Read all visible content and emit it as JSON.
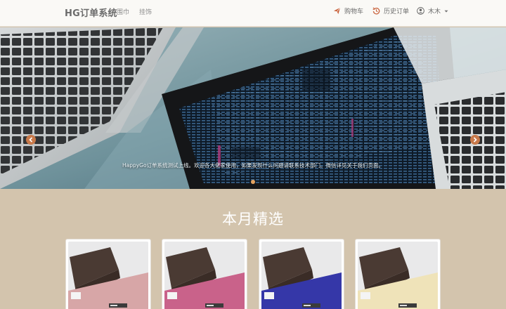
{
  "navbar": {
    "brand": "HG订单系统",
    "links": [
      "围巾",
      "挂饰"
    ],
    "cart_label": "购物车",
    "history_label": "历史订单",
    "user_label": "木木"
  },
  "carousel": {
    "caption": "HappyGo订单系统测试上线。欢迎各大佬家使用，如果发现什么问题请联系技术部门。微信详见关于我们页面。"
  },
  "section": {
    "title": "本月精选"
  },
  "products": [
    {
      "fabric_color": "#d7a6a7"
    },
    {
      "fabric_color": "#c9628a"
    },
    {
      "fabric_color": "#3537a8"
    },
    {
      "fabric_color": "#efe3b9"
    }
  ]
}
